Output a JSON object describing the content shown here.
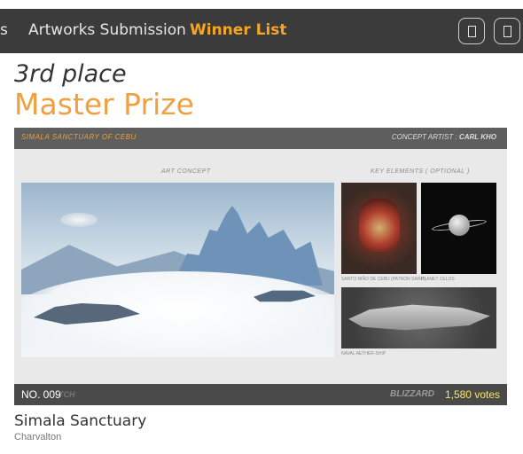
{
  "nav": {
    "prev_label": "s",
    "artworks_label": "Artworks Submission",
    "winner_label": "Winner List",
    "accent_color": "#f5a623",
    "button_a_icon": "rectangle-icon",
    "button_b_icon": "rectangle-icon"
  },
  "award": {
    "place": "3rd place",
    "prize": "Master Prize"
  },
  "artwork": {
    "title": "SIMALA SANCTUARY OF CEBU",
    "artist_label": "CONCEPT ARTIST :",
    "artist_name": "CARL KHO",
    "section_concept": "ART CONCEPT",
    "section_key": "KEY ELEMENTS  ( OPTIONAL )",
    "caption_1": "SANTO NIÑO DE CEBU (PATRON SAINT)",
    "caption_2": "PLANET CELOS",
    "caption_3": "NAVAL AETHER-SHIP",
    "number": "NO. 009",
    "logo_text": "TCH",
    "brand_text": "BLIZZARD",
    "votes": "1,580 votes"
  },
  "entry": {
    "title": "Simala Sanctuary",
    "author": "Charvalton"
  }
}
